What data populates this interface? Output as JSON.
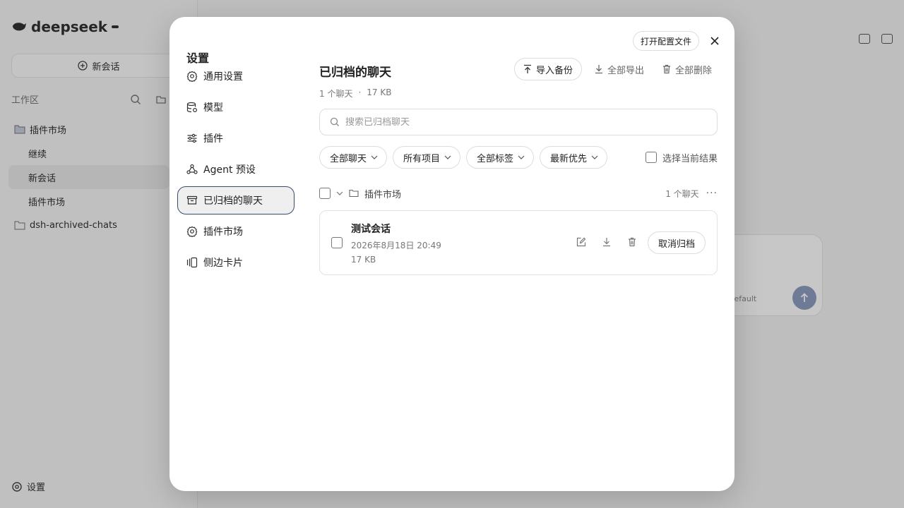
{
  "background": {
    "brand": "deepseek",
    "brand_badge": "",
    "new_chat": "新会话",
    "workspace_label": "工作区",
    "tree": [
      "插件市场",
      "继续",
      "新会话",
      "插件市场",
      "dsh-archived-chats"
    ],
    "settings_label": "设置",
    "model_label": "Default"
  },
  "modal": {
    "title": "设置",
    "open_config": "打开配置文件",
    "nav": [
      {
        "label": "通用设置",
        "icon": "gear-icon"
      },
      {
        "label": "模型",
        "icon": "database-icon"
      },
      {
        "label": "插件",
        "icon": "sliders-icon"
      },
      {
        "label": "Agent 预设",
        "icon": "agent-icon"
      },
      {
        "label": "已归档的聊天",
        "icon": "archive-icon",
        "active": true
      },
      {
        "label": "插件市场",
        "icon": "gear-icon"
      },
      {
        "label": "侧边卡片",
        "icon": "cards-icon"
      }
    ]
  },
  "archived": {
    "title": "已归档的聊天",
    "count": "1 个聊天",
    "separator": "·",
    "size": "17 KB",
    "import_label": "导入备份",
    "export_label": "全部导出",
    "delete_label": "全部删除",
    "search_placeholder": "搜索已归档聊天",
    "filters": [
      "全部聊天",
      "所有项目",
      "全部标签",
      "最新优先"
    ],
    "select_current": "选择当前结果",
    "group": {
      "name": "插件市场",
      "count": "1 个聊天"
    },
    "items": [
      {
        "title": "测试会话",
        "date": "2026年8月18日 20:49",
        "size": "17 KB",
        "unarchive": "取消归档"
      }
    ]
  },
  "colors": {
    "active_border": "#394b6b",
    "send_button": "#8e9dc0"
  }
}
